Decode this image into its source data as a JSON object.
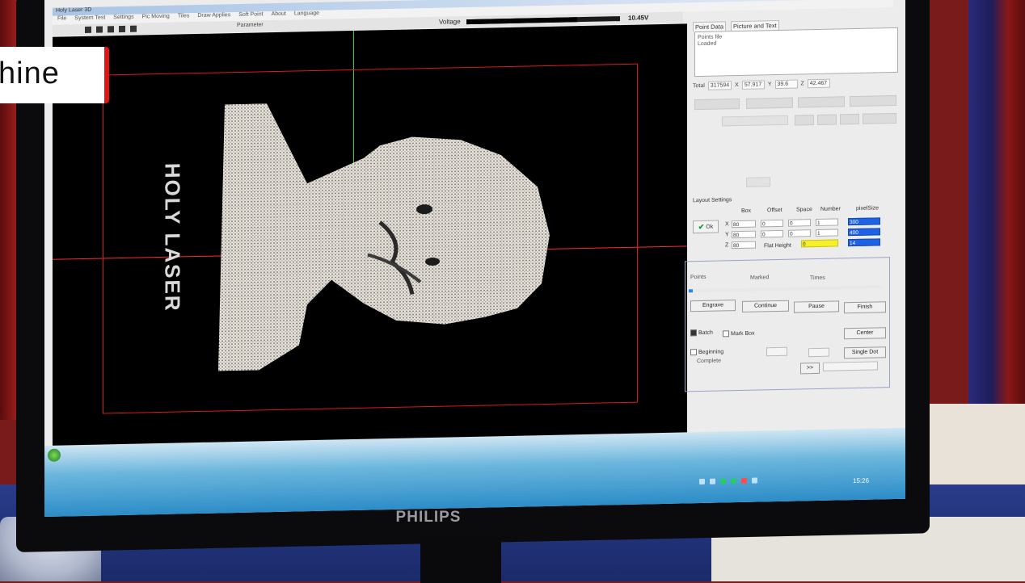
{
  "overlay_caption": "hine",
  "monitor_brand": "PHILIPS",
  "app": {
    "title": "Holy Laser 3D",
    "menu": [
      "File",
      "System Test",
      "Settings",
      "Pic Moving",
      "Tiles",
      "Draw Applies",
      "Soft Point",
      "About",
      "Language"
    ],
    "toolbar_params_label": "Parameter",
    "voltage_label": "Voltage",
    "voltage_value": "10.45V",
    "voltage_fraction": 0.72
  },
  "canvas": {
    "caption": "HOLY LASER"
  },
  "panel": {
    "tabs": [
      "Point Data",
      "Picture and Text"
    ],
    "pointdata_lines": [
      "Points file",
      "Loaded"
    ],
    "total_label": "Total",
    "total_value": "317594",
    "x_label": "X",
    "x_value": "57.917",
    "y_label": "Y",
    "y_value": "39.6",
    "z_label": "Z",
    "z_value": "42.467",
    "layout_title": "Layout Settings",
    "ok_label": "Ok",
    "col_headers": [
      "Box",
      "Offset",
      "Space",
      "Number",
      "pixelSize"
    ],
    "rows": [
      {
        "axis": "X",
        "box": "80",
        "offset": "0",
        "space": "0",
        "number": "1",
        "pixel": "300"
      },
      {
        "axis": "Y",
        "box": "80",
        "offset": "0",
        "space": "0",
        "number": "1",
        "pixel": "400"
      },
      {
        "axis": "Z",
        "box": "80",
        "pixel": "14"
      }
    ],
    "flat_height_label": "Flat Height",
    "flat_height_value": "0",
    "engrave_group": {
      "points_label": "Points",
      "marked_label": "Marked",
      "times_label": "Times",
      "progress": 0.02,
      "engrave_btn": "Engrave",
      "continue_btn": "Continue",
      "pause_btn": "Pause",
      "finish_btn": "Finish",
      "batch_label": "Batch",
      "mark_box_label": "Mark Box",
      "center_btn": "Center",
      "beginning_label": "Beginning",
      "complete_label": "Complete",
      "single_dot_btn": "Single Dot",
      "next_btn": ">>"
    }
  },
  "taskbar": {
    "clock": "15:26"
  }
}
